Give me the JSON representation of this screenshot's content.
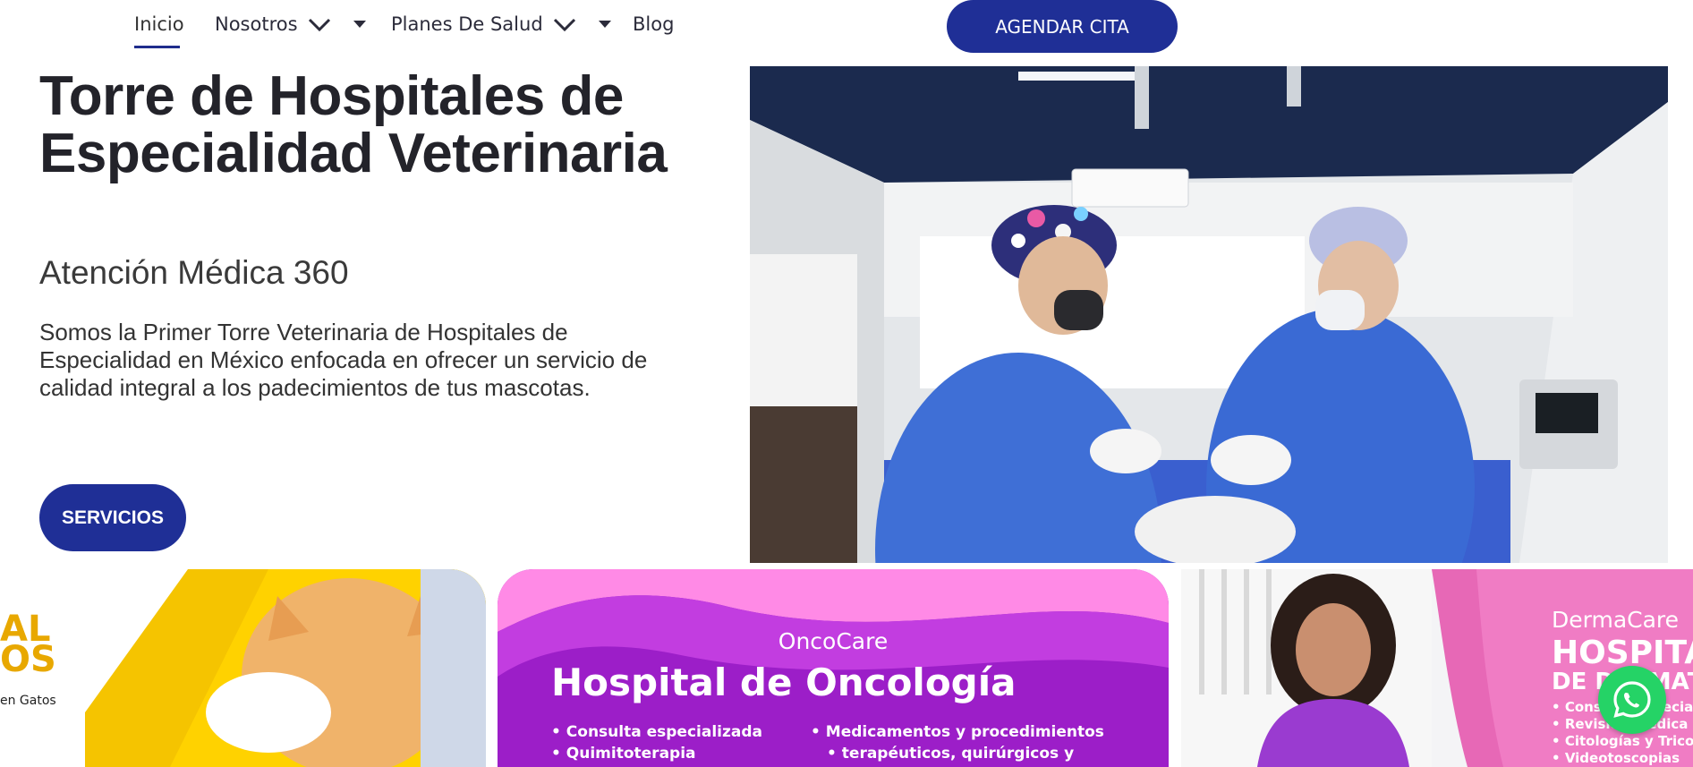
{
  "nav": {
    "items": [
      {
        "label": "Inicio"
      },
      {
        "label": "Nosotros"
      },
      {
        "label": "Planes De Salud"
      },
      {
        "label": "Blog"
      }
    ],
    "cta_label": "AGENDAR CITA"
  },
  "hero": {
    "title": "Torre de Hospitales de Especialidad Veterinaria",
    "subtitle": "Atención Médica 360",
    "description": "Somos la Primer Torre Veterinaria de Hospitales de Especialidad en México enfocada en ofrecer un servicio de calidad integral a los padecimientos de tus mascotas.",
    "button_label": "SERVICIOS"
  },
  "banners": {
    "cats": {
      "partial_title": "AL\nOS",
      "partial_small": "OS",
      "partial_caption": "en Gatos"
    },
    "onco": {
      "label": "OncoCare",
      "title": "Hospital de Oncología",
      "list_left": [
        "Consulta especializada",
        "Quimitoterapia"
      ],
      "list_right": [
        "Medicamentos y procedimientos",
        "terapéuticos, quirúrgicos y"
      ]
    },
    "derma": {
      "label": "DermaCare",
      "title_line1": "HOSPITA",
      "title_line2": "DE DERMATO",
      "list": [
        "Consulta especial",
        "Revisión médica",
        "Citologías y Tricog",
        "Videotoscopias"
      ]
    }
  },
  "colors": {
    "brand_blue": "#1f2f96",
    "onco_purple": "#9c1ec8",
    "derma_pink": "#e36bb6",
    "whatsapp_green": "#25d366"
  },
  "icons": {
    "nav_chevron": "chevron-down-icon",
    "nav_caret": "caret-down-icon",
    "whatsapp": "whatsapp-icon"
  }
}
